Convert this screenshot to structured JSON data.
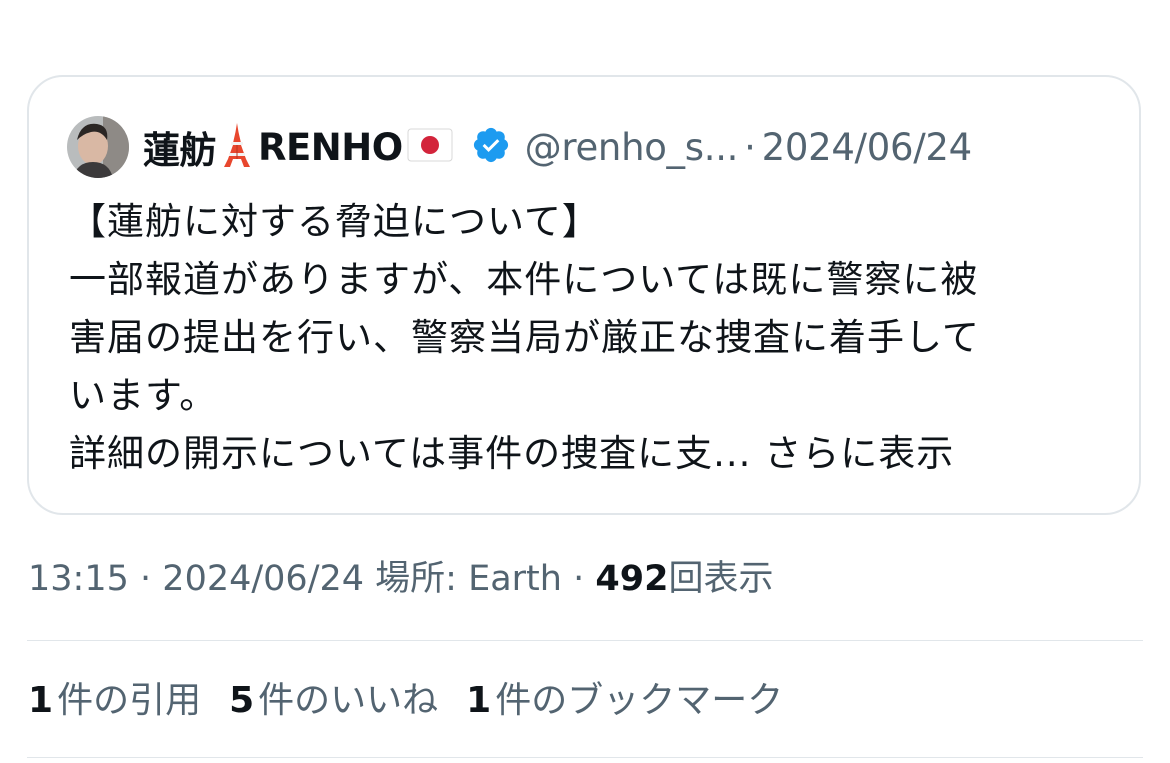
{
  "quoted_tweet": {
    "display_name": "蓮舫",
    "display_name_suffix": "RENHO",
    "handle": "@renho_s...",
    "separator": "·",
    "date": "2024/06/24",
    "text_lines": [
      "【蓮舫に対する脅迫について】",
      "一部報道がありますが、本件については既に警察に被",
      "害届の提出を行い、警察当局が厳正な捜査に着手して",
      "います。",
      "詳細の開示については事件の捜査に支..."
    ],
    "show_more": "さらに表示",
    "icons": {
      "avatar": "avatar-photo",
      "tower_emoji": "tokyo-tower-emoji",
      "flag_emoji": "japan-flag-emoji",
      "verified": "verified-badge-icon"
    },
    "colors": {
      "verified": "#1d9bf0",
      "secondary_text": "#536471"
    }
  },
  "meta": {
    "time": "13:15",
    "sep1": "·",
    "date": "2024/06/24",
    "location": "場所: Earth",
    "sep2": "·",
    "views_count": "492",
    "views_label": "回表示"
  },
  "stats": {
    "quotes_count": "1",
    "quotes_label": "件の引用",
    "likes_count": "5",
    "likes_label": "件のいいね",
    "bookmarks_count": "1",
    "bookmarks_label": "件のブックマーク"
  }
}
